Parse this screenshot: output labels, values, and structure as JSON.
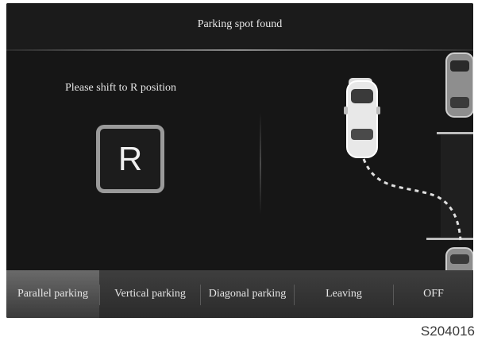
{
  "header": {
    "title": "Parking spot found"
  },
  "main": {
    "instruction": "Please shift to R position",
    "gear": "R"
  },
  "tabs": [
    {
      "label": "Parallel parking",
      "active": true
    },
    {
      "label": "Vertical parking",
      "active": false
    },
    {
      "label": "Diagonal parking",
      "active": false
    },
    {
      "label": "Leaving",
      "active": false
    },
    {
      "label": "OFF",
      "active": false
    }
  ],
  "figure_code": "S204016",
  "icons": [
    "car-icon",
    "parked-car-icon",
    "parking-path-icon"
  ]
}
